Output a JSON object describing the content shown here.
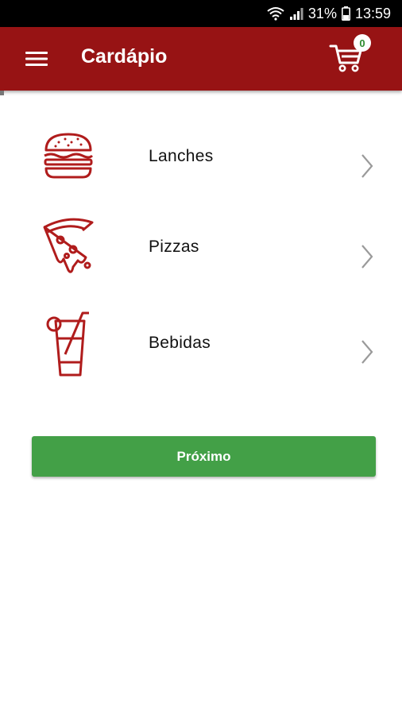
{
  "status_bar": {
    "battery_percent": "31%",
    "time": "13:59",
    "icons": [
      "wifi-icon",
      "signal-icon",
      "battery-icon"
    ]
  },
  "app_bar": {
    "title": "Cardápio",
    "menu_icon": "menu-icon",
    "cart_icon": "cart-icon",
    "cart_count": "0",
    "background": "#971314"
  },
  "categories": [
    {
      "label": "Lanches",
      "icon": "burger-icon"
    },
    {
      "label": "Pizzas",
      "icon": "pizza-icon"
    },
    {
      "label": "Bebidas",
      "icon": "drink-icon"
    }
  ],
  "next_button": {
    "label": "Próximo",
    "color": "#43a047"
  },
  "colors": {
    "primary": "#971314",
    "accent_green": "#43a047",
    "icon_red": "#b01c1c"
  }
}
